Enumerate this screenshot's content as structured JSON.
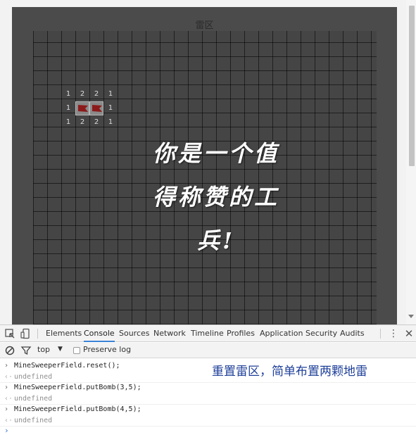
{
  "game": {
    "title": "雷区",
    "overlay_lines": [
      "你是一个值",
      "得称赞的工",
      "兵!"
    ],
    "cells": [
      {
        "row": 0,
        "col": 0,
        "text": "1"
      },
      {
        "row": 0,
        "col": 1,
        "text": "2"
      },
      {
        "row": 0,
        "col": 2,
        "text": "2"
      },
      {
        "row": 0,
        "col": 3,
        "text": "1"
      },
      {
        "row": 1,
        "col": 0,
        "text": "1"
      },
      {
        "row": 1,
        "col": 1,
        "flag": true
      },
      {
        "row": 1,
        "col": 2,
        "flag": true
      },
      {
        "row": 1,
        "col": 3,
        "text": "1"
      },
      {
        "row": 2,
        "col": 0,
        "text": "1"
      },
      {
        "row": 2,
        "col": 1,
        "text": "2"
      },
      {
        "row": 2,
        "col": 2,
        "text": "2"
      },
      {
        "row": 2,
        "col": 3,
        "text": "1"
      }
    ],
    "flag_color": "#8c1a1a"
  },
  "devtools": {
    "tabs": [
      "Elements",
      "Console",
      "Sources",
      "Network",
      "Timeline",
      "Profiles",
      "Application",
      "Security",
      "Audits"
    ],
    "active_tab": "Console",
    "toolbar": {
      "context": "top",
      "preserve_log": "Preserve log"
    },
    "annotation": "重置雷区，简单布置两颗地雷",
    "console_lines": [
      {
        "type": "in",
        "text": "MineSweeperField.reset();"
      },
      {
        "type": "out",
        "text": "undefined"
      },
      {
        "type": "in",
        "text": "MineSweeperField.putBomb(3,5);"
      },
      {
        "type": "out",
        "text": "undefined"
      },
      {
        "type": "in",
        "text": "MineSweeperField.putBomb(4,5);"
      },
      {
        "type": "out",
        "text": "undefined"
      }
    ],
    "accent_color": "#3b82d6"
  }
}
